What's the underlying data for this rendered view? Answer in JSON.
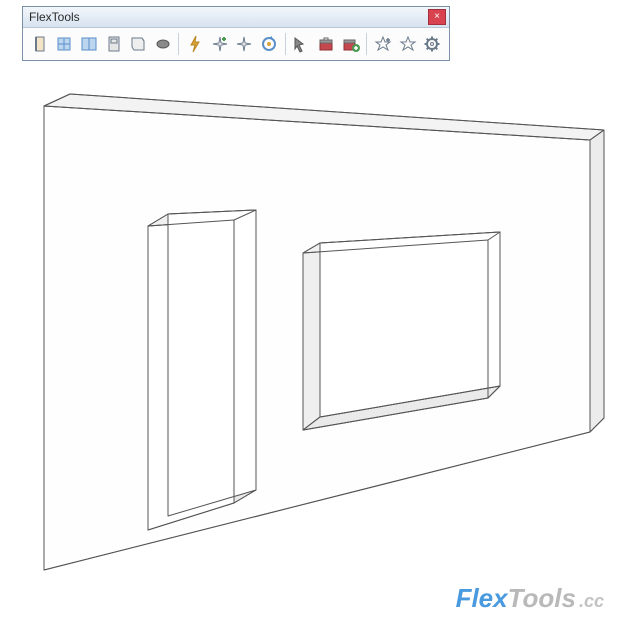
{
  "toolbar": {
    "title": "FlexTools",
    "close_label": "×",
    "buttons": [
      {
        "name": "door-icon"
      },
      {
        "name": "window-icon"
      },
      {
        "name": "double-window-icon"
      },
      {
        "name": "panel-icon"
      },
      {
        "name": "wall-icon"
      },
      {
        "name": "disc-icon"
      },
      {
        "sep": true
      },
      {
        "name": "zap-icon"
      },
      {
        "name": "sparkle-plus-icon"
      },
      {
        "name": "sparkle-icon"
      },
      {
        "name": "refresh-icon"
      },
      {
        "sep": true
      },
      {
        "name": "pick-icon"
      },
      {
        "name": "toolbox-icon"
      },
      {
        "name": "toolbox-plus-icon"
      },
      {
        "sep": true
      },
      {
        "name": "star-plus-icon"
      },
      {
        "name": "star-icon"
      },
      {
        "name": "gear-icon"
      }
    ]
  },
  "watermark": {
    "flex": "Flex",
    "tools": "Tools",
    "suffix": ".cc"
  }
}
